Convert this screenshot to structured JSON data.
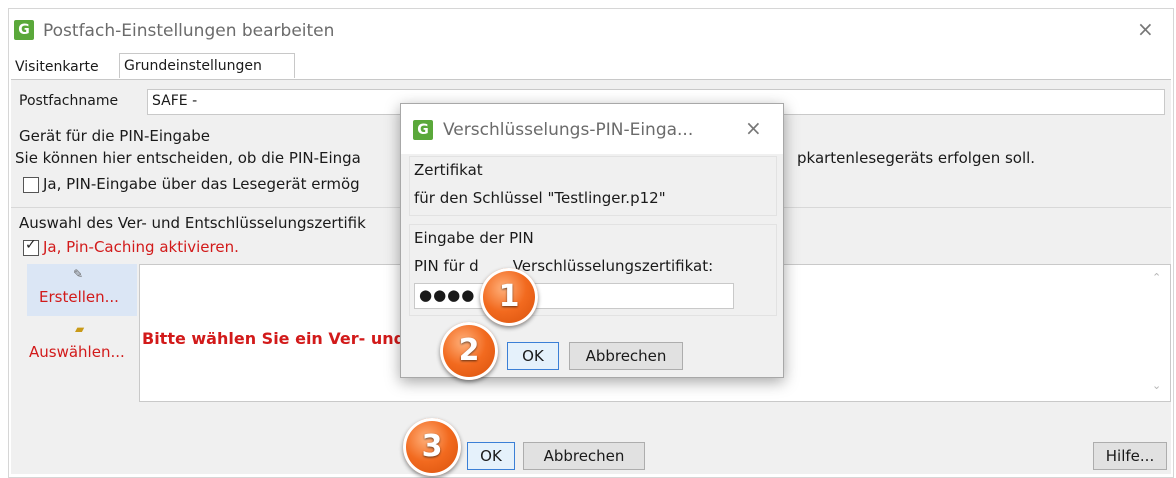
{
  "main_window": {
    "title": "Postfach-Einstellungen bearbeiten",
    "app_icon_glyph": "G",
    "close_glyph": "×",
    "tabs": [
      {
        "label": "Visitenkarte",
        "active": false
      },
      {
        "label": "Grundeinstellungen",
        "active": true
      }
    ],
    "postfachname_label": "Postfachname",
    "postfachname_value": "SAFE -",
    "pin_device_heading": "Gerät für die PIN-Eingabe",
    "pin_device_desc_left": "Sie können hier entscheiden, ob die PIN-Einga",
    "pin_device_desc_right": "pkartenlesegeräts erfolgen soll.",
    "pin_device_checkbox_label": "Ja, PIN-Eingabe über das Lesegerät ermög",
    "cert_heading": "Auswahl des Ver- und Entschlüsselungszertifik",
    "pin_caching_label": "Ja, Pin-Caching aktivieren.",
    "pin_caching_checked": true,
    "create_label": "Erstellen...",
    "select_label": "Auswählen...",
    "cert_warning": "Bitte wählen Sie ein Ver- und",
    "ok_label": "OK",
    "cancel_label": "Abbrechen",
    "help_label": "Hilfe...",
    "scroll_up": "⌃",
    "scroll_down": "⌄"
  },
  "dialog": {
    "title": "Verschlüsselungs-PIN-Einga...",
    "app_icon_glyph": "G",
    "close_glyph": "×",
    "cert_group_label": "Zertifikat",
    "cert_text": "für den Schlüssel \"Testlinger.p12\"",
    "pin_group_label": "Eingabe der PIN",
    "pin_field_label_a": "PIN für d",
    "pin_field_label_b": "Verschlüsselungszertifikat:",
    "pin_value": "●●●●",
    "ok_label": "OK",
    "cancel_label": "Abbrechen"
  },
  "badges": [
    "1",
    "2",
    "3"
  ],
  "colors": {
    "accent_red": "#d21a1a",
    "badge_orange": "#f26a1f",
    "app_icon_green": "#5aa83a",
    "default_button_border": "#3b7fd6"
  }
}
